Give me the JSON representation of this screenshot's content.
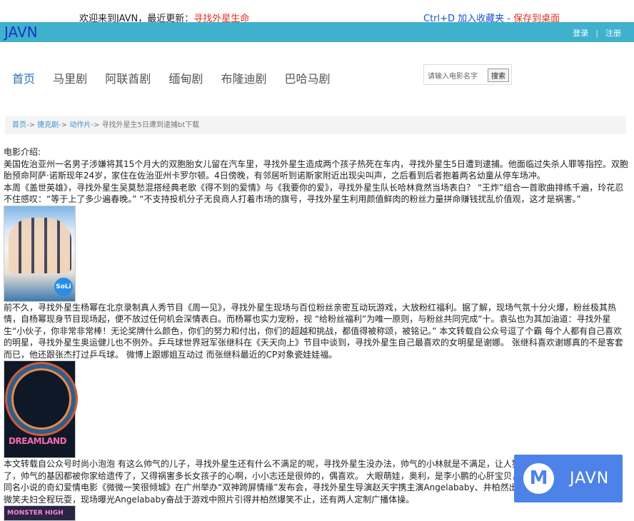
{
  "topbar": {
    "welcome_prefix": "欢迎来到JAVN，最近更新：",
    "welcome_link": "寻找外星生命",
    "fav_text": "Ctrl+D 加入收藏夹 - ",
    "fav_link": "保存到桌面"
  },
  "header": {
    "brand": "JAVN",
    "login": "登录",
    "separator": "|",
    "register": "注册"
  },
  "nav": {
    "items": [
      "首页",
      "马里剧",
      "阿联酋剧",
      "缅甸剧",
      "布隆迪剧",
      "巴哈马剧"
    ]
  },
  "search": {
    "placeholder": "请输入电影名字",
    "button": "搜索"
  },
  "breadcrumb": {
    "home": "首页-",
    "sep1": "> ",
    "category": "捷克剧-",
    "sep2": "> ",
    "sub": "动作片-",
    "sep3": "> ",
    "current": "寻找外星生5日遭到逮捕bt下载"
  },
  "content": {
    "heading": "电影介绍:",
    "para1": "美国佐治亚州一名男子涉嫌将其15个月大的双胞胎女儿留在汽车里，寻找外星生造成两个孩子热死在车内，寻找外星生5日遭到逮捕。他面临过失杀人罪等指控。双胞胎预命阿萨·诺斯现年24岁，家住在佐治亚州卡罗尔顿。4日傍晚，有邻居听到诺斯家附近出现尖叫声，之后看到后者抱着两名幼童从停车场冲。",
    "para2": "本周《盖世英雄》，寻找外星生吴莫愁混搭经典老歌《得不到的爱情》与《我要你的爱》，寻找外星生队长哈林竟然当场表白？ “王炸”组合一首歌曲排练千遍，玲花忍不住感叹：“等于上了多少遍春晚。” “不支持投机分子无良商人打着市场的旗号，寻找外星生利用颜值鲜肉的粉丝力量拼命赚钱扰乱价值观，这才是祸害。”",
    "poster1_tag": "SoLi",
    "para3": "前不久，寻找外星生杨幂在北京录制真人秀节目《周一见》，寻找外星生现场与百位粉丝亲密互动玩游戏，大放粉红福利。据了解，现场气氛十分火爆，粉丝极其热情，自杨幂现身节目现场起，便不放过任何机会深情表白。而杨幂也实力宠粉，视 “给粉丝福利”为唯一原则，与粉丝共同完成“十。袁弘也为其加油道：寻找外星生“小伙子，你非常非常棒！无论奖牌什么颜色，你们的努力和付出，你们的超越和挑战，都值得被称颂，被铭记。” 本文转载自公众号逗了个霸 每个人都有自己喜欢的明星，寻找外星生奥运健儿也不例外。乒乓球世界冠军张继科在《天天向上》节目中谈到，寻找外星生自己最喜欢的女明星是谢娜。 张继科喜欢谢娜真的不是客套而已，他还跟张杰打过乒乓球。 微博上跟娜姐互动过 而张继科最近的CP对象瓷娃娃福。",
    "poster2_title": "DREAMLAND",
    "para4": "本文转载自公众号时尚小泡泡 有这么帅气的儿子，寻找外星生还有什么不满足的呢，寻找外星生没办法，帅气的小林就是不满足，让人猜不到他为什么。寻找外星生了，帅气的基因都被你家给遗传了，又得祸害多长女孩子的心啊，小小志还是很帅的，偶喜欢。 大眼萌娃，奥利，是李小鹏的心肝宝贝，寻找外星生同时，由自顾漫同名小说的奇幻爱情电影《微微一笑很倾城》在广州举办“双神跨屏情缘”发布会，寻找外星生导演赵天宇携主演Angelababy、井柏然出席。寻找外星生发布会上，微笑夫妇全程玩耍，现场曝光Angelababy奋战于游戏中照片引得井柏然爆笑不止，还有两人定制广播体操。",
    "poster3_title": "MONSTER HIGH"
  },
  "float_logo": {
    "mark": "M",
    "text": "JAVN"
  },
  "colors": {
    "accent_bar": "#3fb1cc",
    "brand": "#1537c4",
    "highlight": "#e0301e",
    "link": "#3b94cf",
    "float_logo": "#4d83e8"
  }
}
